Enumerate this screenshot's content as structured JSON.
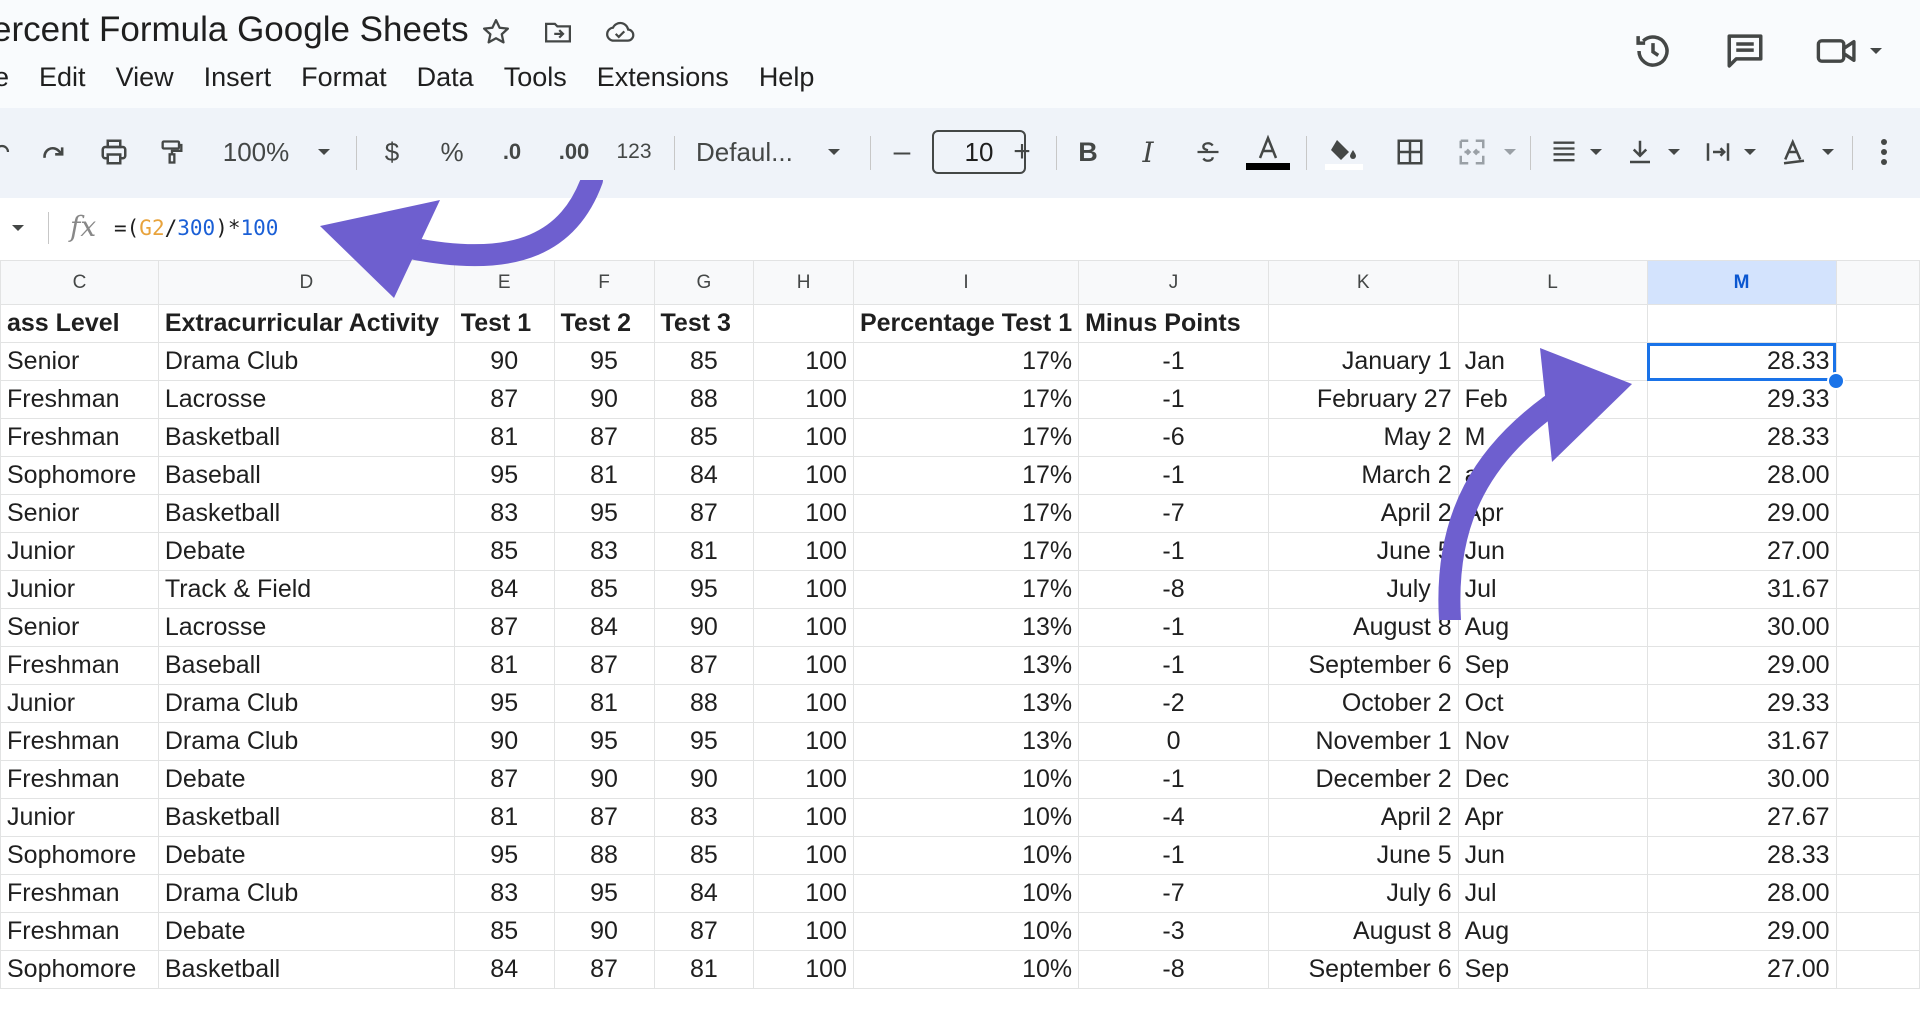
{
  "title": "ercent Formula Google Sheets",
  "menu": [
    "e",
    "Edit",
    "View",
    "Insert",
    "Format",
    "Data",
    "Tools",
    "Extensions",
    "Help"
  ],
  "toolbar": {
    "zoom": "100%",
    "currency": "$",
    "percent": "%",
    "dec_decrease": ".0",
    "dec_increase": ".00",
    "format_123": "123",
    "font": "Defaul...",
    "font_size": "10",
    "bold": "B",
    "italic": "I",
    "minus": "–",
    "plus": "+"
  },
  "formula_bar": {
    "fx": "fx",
    "parts": [
      "=(",
      "G2",
      "/",
      "300",
      ")*",
      "100"
    ]
  },
  "columns": [
    "C",
    "D",
    "E",
    "F",
    "G",
    "H",
    "I",
    "J",
    "K",
    "L",
    "M"
  ],
  "header_row": [
    "ass Level",
    "Extracurricular Activity",
    "Test 1",
    "Test 2",
    "Test 3",
    "",
    "Percentage Test 1",
    "Minus Points",
    "",
    "",
    ""
  ],
  "rows": [
    [
      "Senior",
      "Drama Club",
      "90",
      "95",
      "85",
      "100",
      "17%",
      "-1",
      "January 1",
      "Jan",
      "28.33"
    ],
    [
      "Freshman",
      "Lacrosse",
      "87",
      "90",
      "88",
      "100",
      "17%",
      "-1",
      "February 27",
      "Feb",
      "29.33"
    ],
    [
      "Freshman",
      "Basketball",
      "81",
      "87",
      "85",
      "100",
      "17%",
      "-6",
      "May 2",
      "M",
      "28.33"
    ],
    [
      "Sophomore",
      "Baseball",
      "95",
      "81",
      "84",
      "100",
      "17%",
      "-1",
      "March 2",
      "ar",
      "28.00"
    ],
    [
      "Senior",
      "Basketball",
      "83",
      "95",
      "87",
      "100",
      "17%",
      "-7",
      "April 2",
      "Apr",
      "29.00"
    ],
    [
      "Junior",
      "Debate",
      "85",
      "83",
      "81",
      "100",
      "17%",
      "-1",
      "June 5",
      "Jun",
      "27.00"
    ],
    [
      "Junior",
      "Track & Field",
      "84",
      "85",
      "95",
      "100",
      "17%",
      "-8",
      "July 6",
      "Jul",
      "31.67"
    ],
    [
      "Senior",
      "Lacrosse",
      "87",
      "84",
      "90",
      "100",
      "13%",
      "-1",
      "August 8",
      "Aug",
      "30.00"
    ],
    [
      "Freshman",
      "Baseball",
      "81",
      "87",
      "87",
      "100",
      "13%",
      "-1",
      "September 6",
      "Sep",
      "29.00"
    ],
    [
      "Junior",
      "Drama Club",
      "95",
      "81",
      "88",
      "100",
      "13%",
      "-2",
      "October 2",
      "Oct",
      "29.33"
    ],
    [
      "Freshman",
      "Drama Club",
      "90",
      "95",
      "95",
      "100",
      "13%",
      "0",
      "November 1",
      "Nov",
      "31.67"
    ],
    [
      "Freshman",
      "Debate",
      "87",
      "90",
      "90",
      "100",
      "10%",
      "-1",
      "December 2",
      "Dec",
      "30.00"
    ],
    [
      "Junior",
      "Basketball",
      "81",
      "87",
      "83",
      "100",
      "10%",
      "-4",
      "April 2",
      "Apr",
      "27.67"
    ],
    [
      "Sophomore",
      "Debate",
      "95",
      "88",
      "85",
      "100",
      "10%",
      "-1",
      "June 5",
      "Jun",
      "28.33"
    ],
    [
      "Freshman",
      "Drama Club",
      "83",
      "95",
      "84",
      "100",
      "10%",
      "-7",
      "July 6",
      "Jul",
      "28.00"
    ],
    [
      "Freshman",
      "Debate",
      "85",
      "90",
      "87",
      "100",
      "10%",
      "-3",
      "August 8",
      "Aug",
      "29.00"
    ],
    [
      "Sophomore",
      "Basketball",
      "84",
      "87",
      "81",
      "100",
      "10%",
      "-8",
      "September 6",
      "Sep",
      "27.00"
    ]
  ],
  "colors": {
    "accent": "#1a73e8",
    "arrow": "#6e5fcf",
    "selected_header": "#d3e3fd"
  }
}
